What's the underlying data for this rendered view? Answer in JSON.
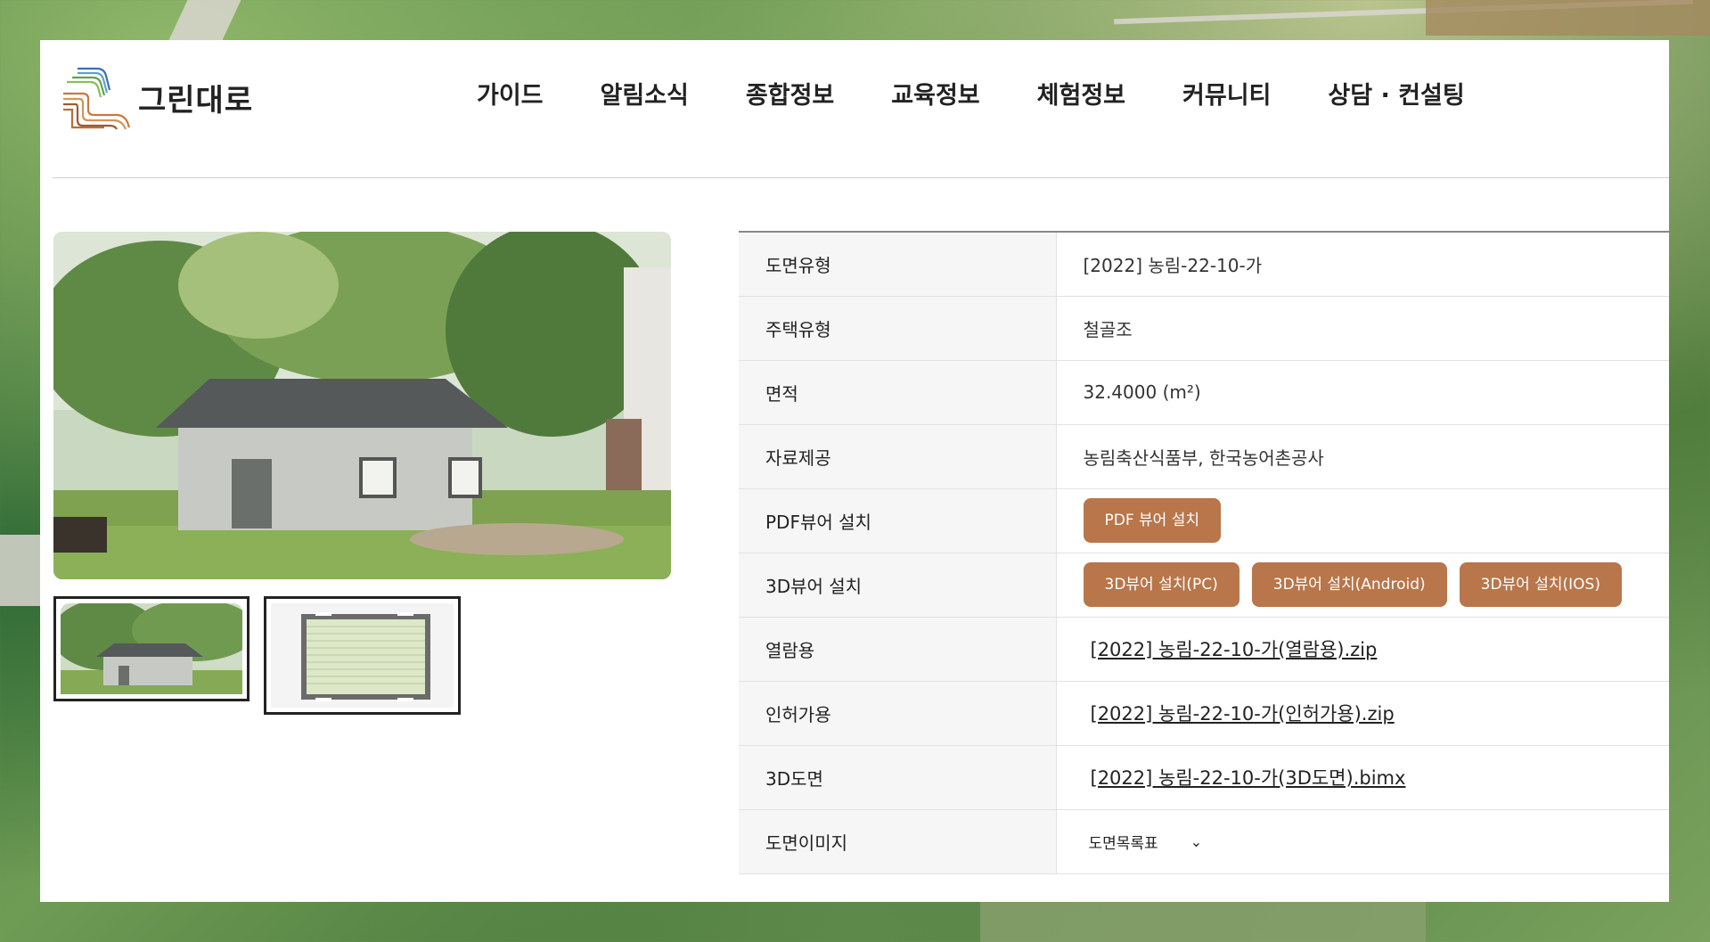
{
  "logo": {
    "text": "그린대로"
  },
  "nav": [
    {
      "label": "가이드"
    },
    {
      "label": "알림소식"
    },
    {
      "label": "종합정보"
    },
    {
      "label": "교육정보"
    },
    {
      "label": "체험정보"
    },
    {
      "label": "커뮤니티"
    },
    {
      "label": "상담 · 컨설팅"
    }
  ],
  "details": {
    "drawing_type_label": "도면유형",
    "drawing_type_value": "[2022] 농림-22-10-가",
    "house_type_label": "주택유형",
    "house_type_value": "철골조",
    "area_label": "면적",
    "area_value": "32.4000 (m²)",
    "source_label": "자료제공",
    "source_value": "농림축산식품부, 한국농어촌공사",
    "pdf_label": "PDF뷰어 설치",
    "pdf_button": "PDF 뷰어 설치",
    "viewer3d_label": "3D뷰어 설치",
    "viewer3d_buttons": [
      "3D뷰어 설치(PC)",
      "3D뷰어 설치(Android)",
      "3D뷰어 설치(IOS)"
    ],
    "view_label": "열람용",
    "view_file": "[2022] 농림-22-10-가(열람용).zip",
    "permit_label": "인허가용",
    "permit_file": "[2022] 농림-22-10-가(인허가용).zip",
    "drawing3d_label": "3D도면",
    "drawing3d_file": "[2022] 농림-22-10-가(3D도면).bimx",
    "image_label": "도면이미지",
    "image_select": "도면목록표"
  },
  "colors": {
    "button": "#b8764a",
    "nav_text": "#222222"
  },
  "icons": {
    "select": "chevron-down-icon"
  }
}
